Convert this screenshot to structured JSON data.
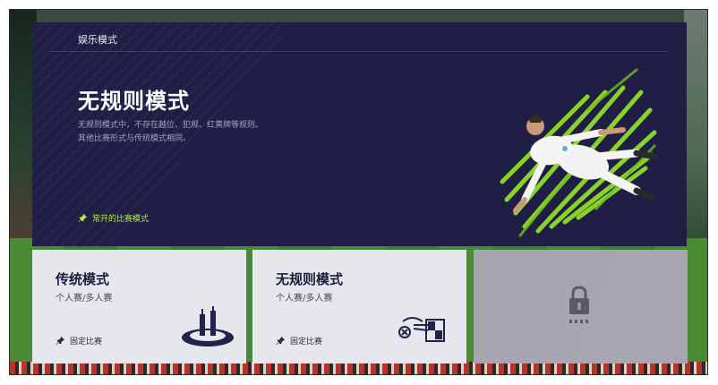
{
  "header": {
    "section_label": "娱乐模式"
  },
  "hero": {
    "title": "无规则模式",
    "description_lines": [
      "无规则模式中，不存在越位、犯规、红黄牌等规则。",
      "其他比赛形式与传统模式相同。"
    ],
    "pin_label": "常开的比赛模式",
    "accent_color": "#b6ef3a"
  },
  "cards": [
    {
      "title": "传统模式",
      "subtitle": "个人赛/多人赛",
      "pin_label": "固定比赛",
      "icon": "trophy-stand-icon"
    },
    {
      "title": "无规则模式",
      "subtitle": "个人赛/多人赛",
      "pin_label": "固定比赛",
      "icon": "no-rules-card-icon"
    },
    {
      "locked": true,
      "icon": "lock-icon"
    }
  ],
  "colors": {
    "hero_bg": "#201e45",
    "card_bg": "#e5e7ec",
    "locked_card_bg": "#a6a5b0"
  }
}
